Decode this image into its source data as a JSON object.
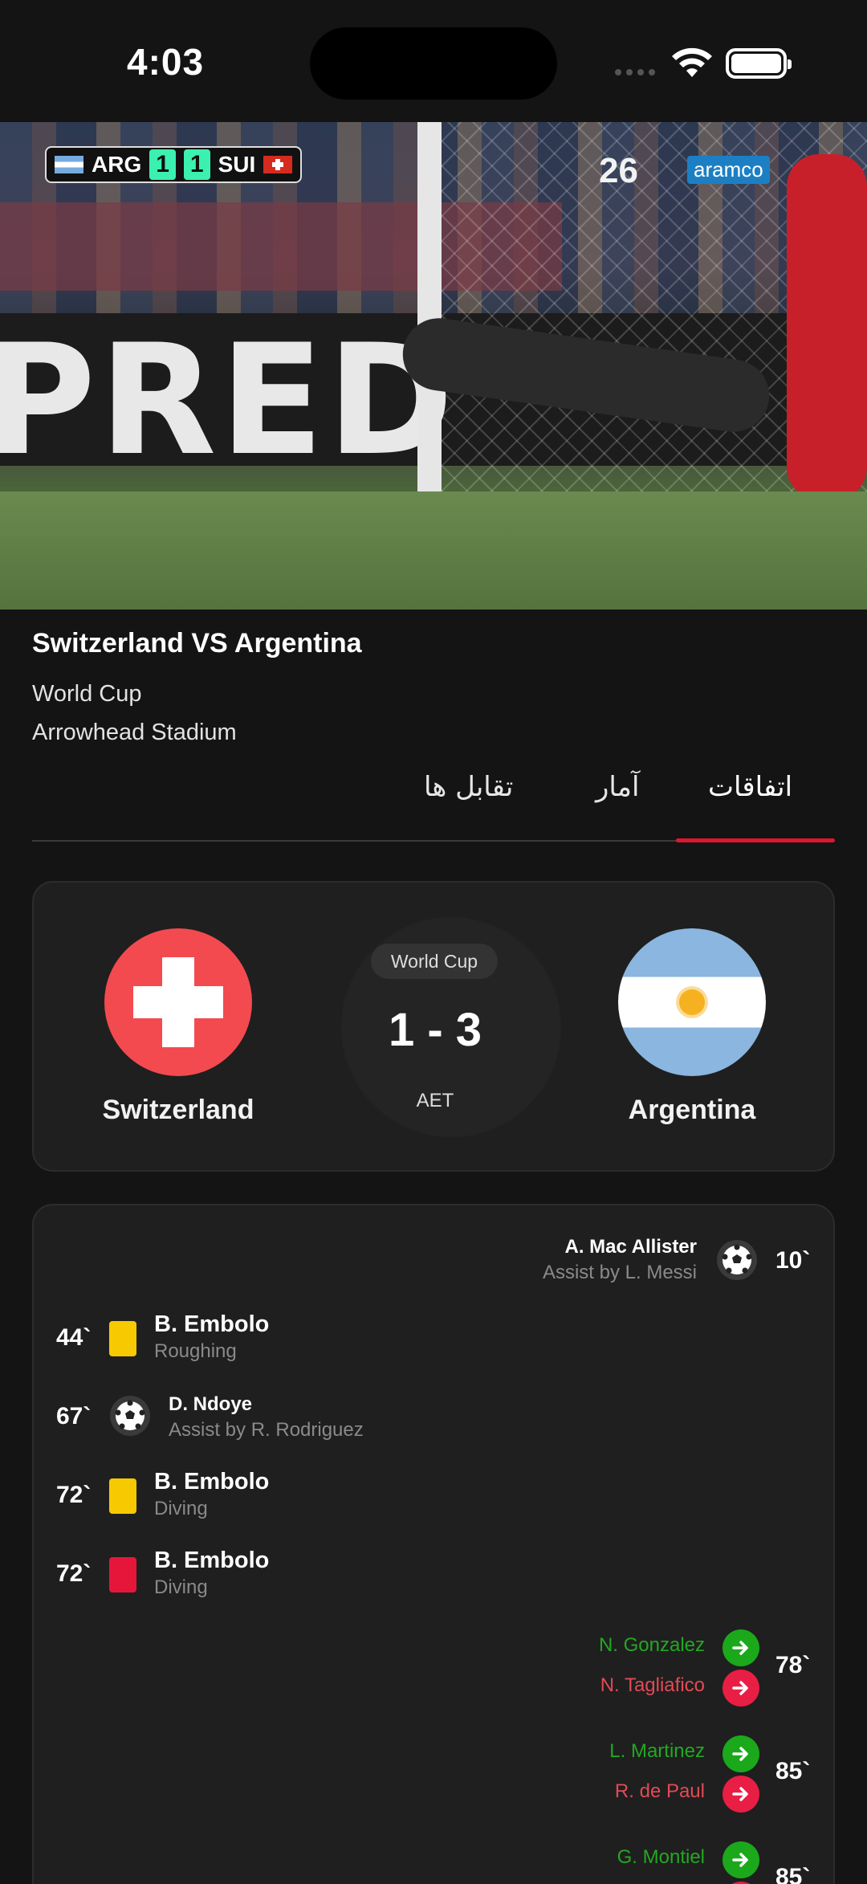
{
  "status_bar": {
    "time": "4:03"
  },
  "video": {
    "scorebug": {
      "home": "ARG",
      "home_score": "1",
      "away_score": "1",
      "away": "SUI"
    },
    "broadcast_logo": "26",
    "sponsor": "aramco",
    "board_text": "PRED"
  },
  "match": {
    "title": "Switzerland VS Argentina",
    "competition": "World Cup",
    "stadium": "Arrowhead Stadium"
  },
  "tabs": [
    {
      "label": "اتفاقات",
      "active": true
    },
    {
      "label": "آمار",
      "active": false
    },
    {
      "label": "تقابل ها",
      "active": false
    }
  ],
  "score_card": {
    "home": "Switzerland",
    "away": "Argentina",
    "competition_badge": "World Cup",
    "score": "1 - 3",
    "status": "AET"
  },
  "events": [
    {
      "minute": "10`",
      "side": "away",
      "type": "goal",
      "player": "A. Mac Allister",
      "detail": "Assist by L. Messi"
    },
    {
      "minute": "44`",
      "side": "home",
      "type": "yellow-card",
      "player": "B. Embolo",
      "detail": "Roughing"
    },
    {
      "minute": "67`",
      "side": "home",
      "type": "goal",
      "player": "D. Ndoye",
      "detail": "Assist by R. Rodriguez"
    },
    {
      "minute": "72`",
      "side": "home",
      "type": "yellow-card",
      "player": "B. Embolo",
      "detail": "Diving"
    },
    {
      "minute": "72`",
      "side": "home",
      "type": "red-card",
      "player": "B. Embolo",
      "detail": "Diving"
    },
    {
      "minute": "78`",
      "side": "away",
      "type": "substitution",
      "player_in": "N. Gonzalez",
      "player_out": "N. Tagliafico"
    },
    {
      "minute": "85`",
      "side": "away",
      "type": "substitution",
      "player_in": "L. Martinez",
      "player_out": "R. de Paul"
    },
    {
      "minute": "85`",
      "side": "away",
      "type": "substitution",
      "player_in": "G. Montiel",
      "player_out": ""
    }
  ],
  "colors": {
    "accent": "#e0162f",
    "sub_in": "#1ba81b",
    "sub_out": "#e81e45",
    "yellow_card": "#f7c900",
    "red_card": "#e6163b"
  }
}
